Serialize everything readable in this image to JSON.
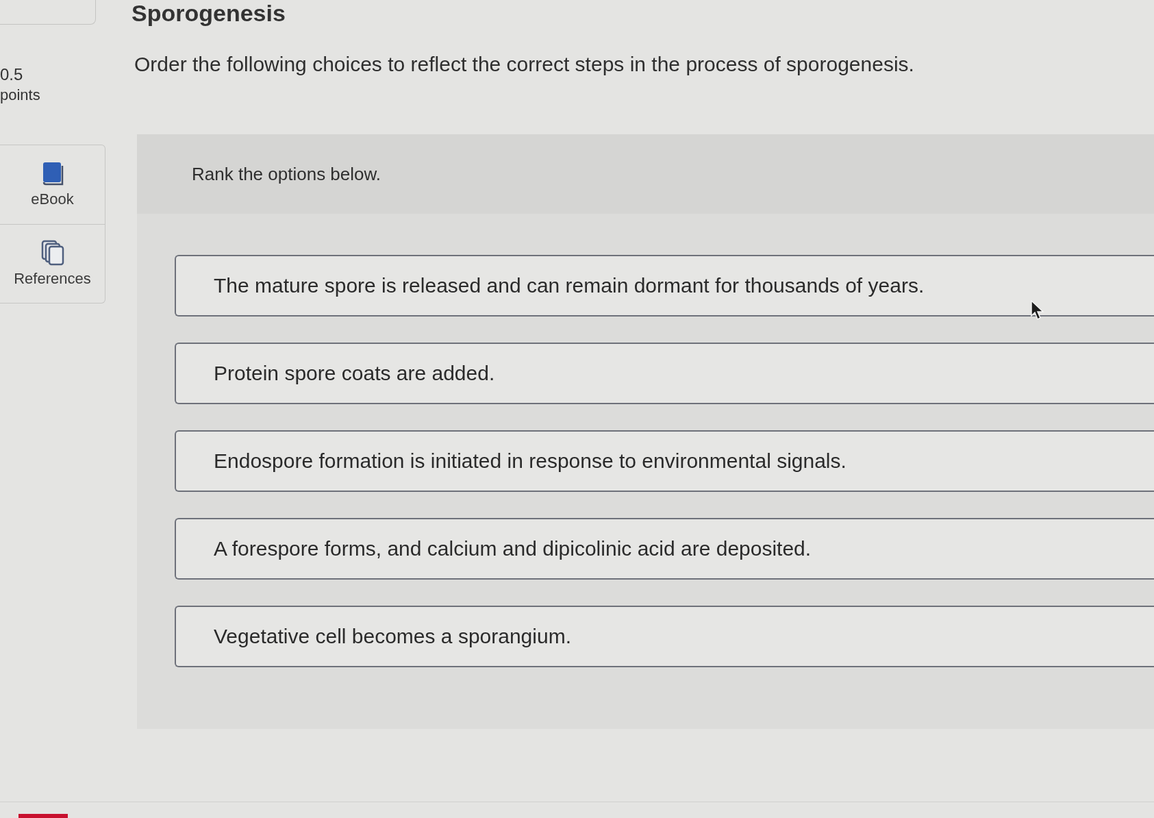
{
  "header": {
    "title": "Sporogenesis"
  },
  "score": {
    "value": "0.5",
    "unit": "points"
  },
  "tools": [
    {
      "kind": "ebook",
      "label": "eBook"
    },
    {
      "kind": "references",
      "label": "References"
    }
  ],
  "question": {
    "prompt": "Order the following choices to reflect the correct steps in the process of sporogenesis.",
    "instruction": "Rank the options below.",
    "options": [
      {
        "text": "The mature spore is released and can remain dormant for thousands of years."
      },
      {
        "text": "Protein spore coats are added."
      },
      {
        "text": "Endospore formation is initiated in response to environmental signals."
      },
      {
        "text": "A forespore forms, and calcium and dipicolinic acid are deposited."
      },
      {
        "text": "Vegetative cell becomes a sporangium."
      }
    ]
  }
}
